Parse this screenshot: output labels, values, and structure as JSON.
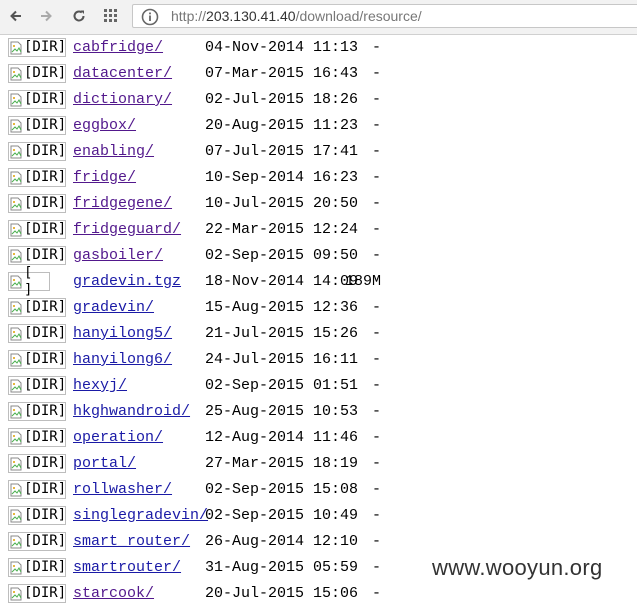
{
  "browser": {
    "url_prefix": "http://",
    "url_host": "203.130.41.40",
    "url_path": "/download/resource/"
  },
  "listing": [
    {
      "alt": "[DIR]",
      "name": "cabfridge/",
      "date": "04-Nov-2014 11:13",
      "size": "-"
    },
    {
      "alt": "[DIR]",
      "name": "datacenter/",
      "date": "07-Mar-2015 16:43",
      "size": "-"
    },
    {
      "alt": "[DIR]",
      "name": "dictionary/",
      "date": "02-Jul-2015 18:26",
      "size": "-"
    },
    {
      "alt": "[DIR]",
      "name": "eggbox/",
      "date": "20-Aug-2015 11:23",
      "size": "-"
    },
    {
      "alt": "[DIR]",
      "name": "enabling/",
      "date": "07-Jul-2015 17:41",
      "size": "-"
    },
    {
      "alt": "[DIR]",
      "name": "fridge/",
      "date": "10-Sep-2014 16:23",
      "size": "-"
    },
    {
      "alt": "[DIR]",
      "name": "fridgegene/",
      "date": "10-Jul-2015 20:50",
      "size": "-"
    },
    {
      "alt": "[DIR]",
      "name": "fridgeguard/",
      "date": "22-Mar-2015 12:24",
      "size": "-"
    },
    {
      "alt": "[DIR]",
      "name": "gasboiler/",
      "date": "02-Sep-2015 09:50",
      "size": "-"
    },
    {
      "alt": "[ ]",
      "name": "gradevin.tgz",
      "date": "18-Nov-2014 14:09",
      "size": "189M"
    },
    {
      "alt": "[DIR]",
      "name": "gradevin/",
      "date": "15-Aug-2015 12:36",
      "size": "-"
    },
    {
      "alt": "[DIR]",
      "name": "hanyilong5/",
      "date": "21-Jul-2015 15:26",
      "size": "-"
    },
    {
      "alt": "[DIR]",
      "name": "hanyilong6/",
      "date": "24-Jul-2015 16:11",
      "size": "-"
    },
    {
      "alt": "[DIR]",
      "name": "hexyj/",
      "date": "02-Sep-2015 01:51",
      "size": "-"
    },
    {
      "alt": "[DIR]",
      "name": "hkghwandroid/",
      "date": "25-Aug-2015 10:53",
      "size": "-"
    },
    {
      "alt": "[DIR]",
      "name": "operation/",
      "date": "12-Aug-2014 11:46",
      "size": "-"
    },
    {
      "alt": "[DIR]",
      "name": "portal/",
      "date": "27-Mar-2015 18:19",
      "size": "-"
    },
    {
      "alt": "[DIR]",
      "name": "rollwasher/",
      "date": "02-Sep-2015 15:08",
      "size": "-"
    },
    {
      "alt": "[DIR]",
      "name": "singlegradevin/",
      "date": "02-Sep-2015 10:49",
      "size": "-"
    },
    {
      "alt": "[DIR]",
      "name": "smart_router/",
      "date": "26-Aug-2014 12:10",
      "size": "-"
    },
    {
      "alt": "[DIR]",
      "name": "smartrouter/",
      "date": "31-Aug-2015 05:59",
      "size": "-"
    },
    {
      "alt": "[DIR]",
      "name": "starcook/",
      "date": "20-Jul-2015 15:06",
      "size": "-"
    }
  ],
  "watermark": "www.wooyun.org",
  "colors": {
    "visited_link": "#52188c",
    "link": "#1a1aa6"
  }
}
